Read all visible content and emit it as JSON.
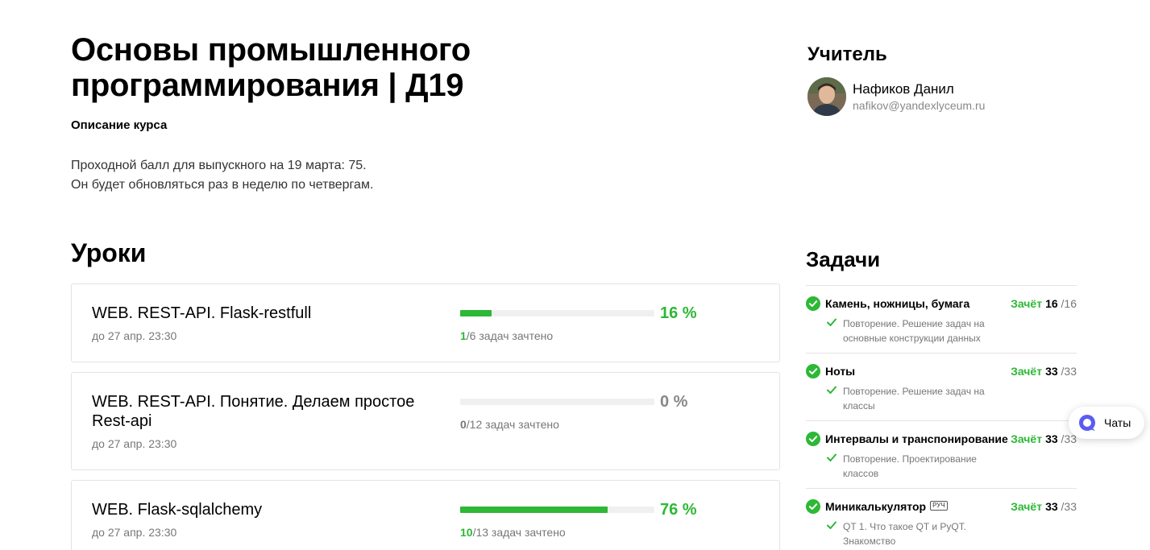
{
  "course": {
    "title": "Основы промышленного программирования | Д19",
    "description_label": "Описание курса",
    "description_lines": [
      "Проходной балл для выпускного на 19 марта: 75.",
      "Он будет обновляться раз в неделю по четвергам."
    ]
  },
  "teacher": {
    "heading": "Учитель",
    "name": "Нафиков Данил",
    "email": "nafikov@yandexlyceum.ru"
  },
  "lessons": {
    "heading": "Уроки",
    "items": [
      {
        "name": "WEB. REST-API. Flask-restfull",
        "due": "до 27 апр. 23:30",
        "progress": 0.16,
        "percent": "16 %",
        "done": "1",
        "tasks_rest": "/6 задач зачтено"
      },
      {
        "name": "WEB. REST-API. Понятие. Делаем простое Rest-api",
        "due": "до 27 апр. 23:30",
        "progress": 0,
        "percent": "0 %",
        "done": "0",
        "tasks_rest": "/12 задач зачтено"
      },
      {
        "name": "WEB. Flask-sqlalchemy",
        "due": "до 27 апр. 23:30",
        "progress": 0.76,
        "percent": "76 %",
        "done": "10",
        "tasks_rest": "/13 задач зачтено"
      }
    ]
  },
  "tasks": {
    "heading": "Задачи",
    "items": [
      {
        "name": "Камень, ножницы, бумага",
        "badge": "",
        "status": "Зачёт",
        "got": "16",
        "total": "/16",
        "sub": "Повторение. Решение задач на основные конструкции данных"
      },
      {
        "name": "Ноты",
        "badge": "",
        "status": "Зачёт",
        "got": "33",
        "total": "/33",
        "sub": "Повторение. Решение задач на классы"
      },
      {
        "name": "Интервалы и транспонирование",
        "badge": "",
        "status": "Зачёт",
        "got": "33",
        "total": "/33",
        "sub": "Повторение. Проектирование классов"
      },
      {
        "name": "Миникалькулятор",
        "badge": "РУЧ",
        "status": "Зачёт",
        "got": "33",
        "total": "/33",
        "sub": "QT 1. Что такое QT и PyQT. Знакомство"
      }
    ]
  },
  "chats": {
    "label": "Чаты"
  },
  "colors": {
    "accent_green": "#2db835",
    "chat_blue": "#5a5cf0"
  },
  "icons": {
    "task_check": "check-circle-icon",
    "sub_check": "check-icon",
    "chats": "chat-bubble-icon"
  }
}
